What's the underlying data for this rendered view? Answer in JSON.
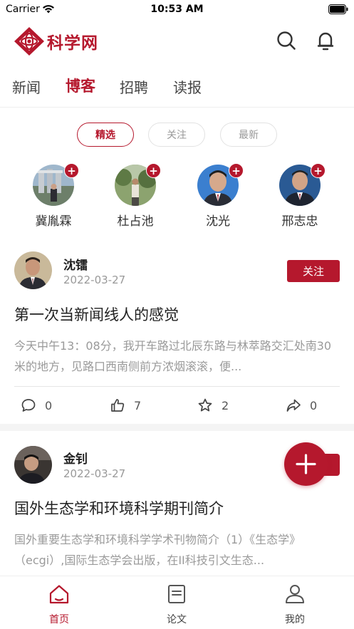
{
  "status": {
    "carrier": "Carrier",
    "time": "10:53 AM"
  },
  "header": {
    "logo_text": "科学网"
  },
  "tabs": [
    {
      "label": "新闻",
      "active": false
    },
    {
      "label": "博客",
      "active": true
    },
    {
      "label": "招聘",
      "active": false
    },
    {
      "label": "读报",
      "active": false
    }
  ],
  "filters": [
    {
      "label": "精选",
      "active": true
    },
    {
      "label": "关注",
      "active": false
    },
    {
      "label": "最新",
      "active": false
    }
  ],
  "authors": [
    {
      "name": "冀胤霖",
      "plus": "+"
    },
    {
      "name": "杜占池",
      "plus": "+"
    },
    {
      "name": "沈光",
      "plus": "+"
    },
    {
      "name": "邢志忠",
      "plus": "+"
    }
  ],
  "posts": [
    {
      "author": "沈镭",
      "date": "2022-03-27",
      "follow_label": "关注",
      "title": "第一次当新闻线人的感觉",
      "excerpt": "今天中午13：08分，我开车路过北辰东路与林萃路交汇处南30米的地方，见路口西南侧前方浓烟滚滚，便...",
      "comments": "0",
      "likes": "7",
      "favorites": "2",
      "shares": "0"
    },
    {
      "author": "金钊",
      "date": "2022-03-27",
      "title": "国外生态学和环境科学期刊简介",
      "excerpt": "国外重要生态学和环境科学学术刊物简介（1）《生态学》（ecgi）,国际生态学会出版，在II科技引文生态..."
    }
  ],
  "bottom_nav": [
    {
      "label": "首页",
      "active": true
    },
    {
      "label": "论文",
      "active": false
    },
    {
      "label": "我的",
      "active": false
    }
  ],
  "colors": {
    "brand": "#b5182d",
    "muted": "#999999",
    "divider": "#e6e6e6"
  }
}
